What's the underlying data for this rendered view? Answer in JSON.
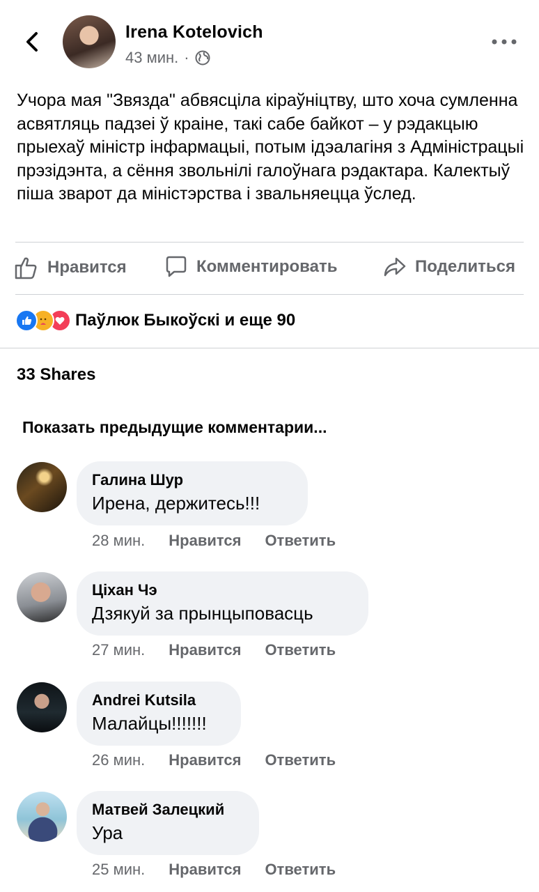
{
  "post": {
    "author": "Irena Kotelovich",
    "time": "43 мин.",
    "separator": "·",
    "text": "Учора мая \"Звязда\" абвясціла кіраўніцтву, што хоча сумленна асвятляць падзеі ў краіне, такі сабе байкот – у рэдакцыю прыехаў міністр інфармацыі, потым ідэалагіня з Адміністрацыі прэзідэнта, а сёння звольнілі галоўнага рэдактара. Калектыў піша зварот да міністэрства і звальняецца ўслед."
  },
  "actions": {
    "like": "Нравится",
    "comment": "Комментировать",
    "share": "Поделиться"
  },
  "reactions": {
    "summary": "Паўлюк Быкоўскі и еще 90",
    "icons": [
      "like-icon",
      "care-icon",
      "love-icon"
    ]
  },
  "shares": "33 Shares",
  "previous_comments": "Показать предыдущие комментарии...",
  "comments": [
    {
      "name": "Галина Шур",
      "text": "Ирена, держитесь!!!",
      "time": "28 мин.",
      "like": "Нравится",
      "reply": "Ответить"
    },
    {
      "name": "Ціхан Чэ",
      "text": "Дзякуй за прынцыповасць",
      "time": "27 мин.",
      "like": "Нравится",
      "reply": "Ответить"
    },
    {
      "name": "Andrei Kutsila",
      "text": "Малайцы!!!!!!!",
      "time": "26 мин.",
      "like": "Нравится",
      "reply": "Ответить"
    },
    {
      "name": "Матвей Залецкий",
      "text": "Ура",
      "time": "25 мин.",
      "like": "Нравится",
      "reply": "Ответить"
    }
  ],
  "colors": {
    "secondary_text": "#65676b",
    "bubble": "#f0f2f5",
    "divider": "#ced0d4",
    "like_blue": "#1877f2",
    "love_red": "#f33e58",
    "care_yellow": "#f7b125"
  }
}
